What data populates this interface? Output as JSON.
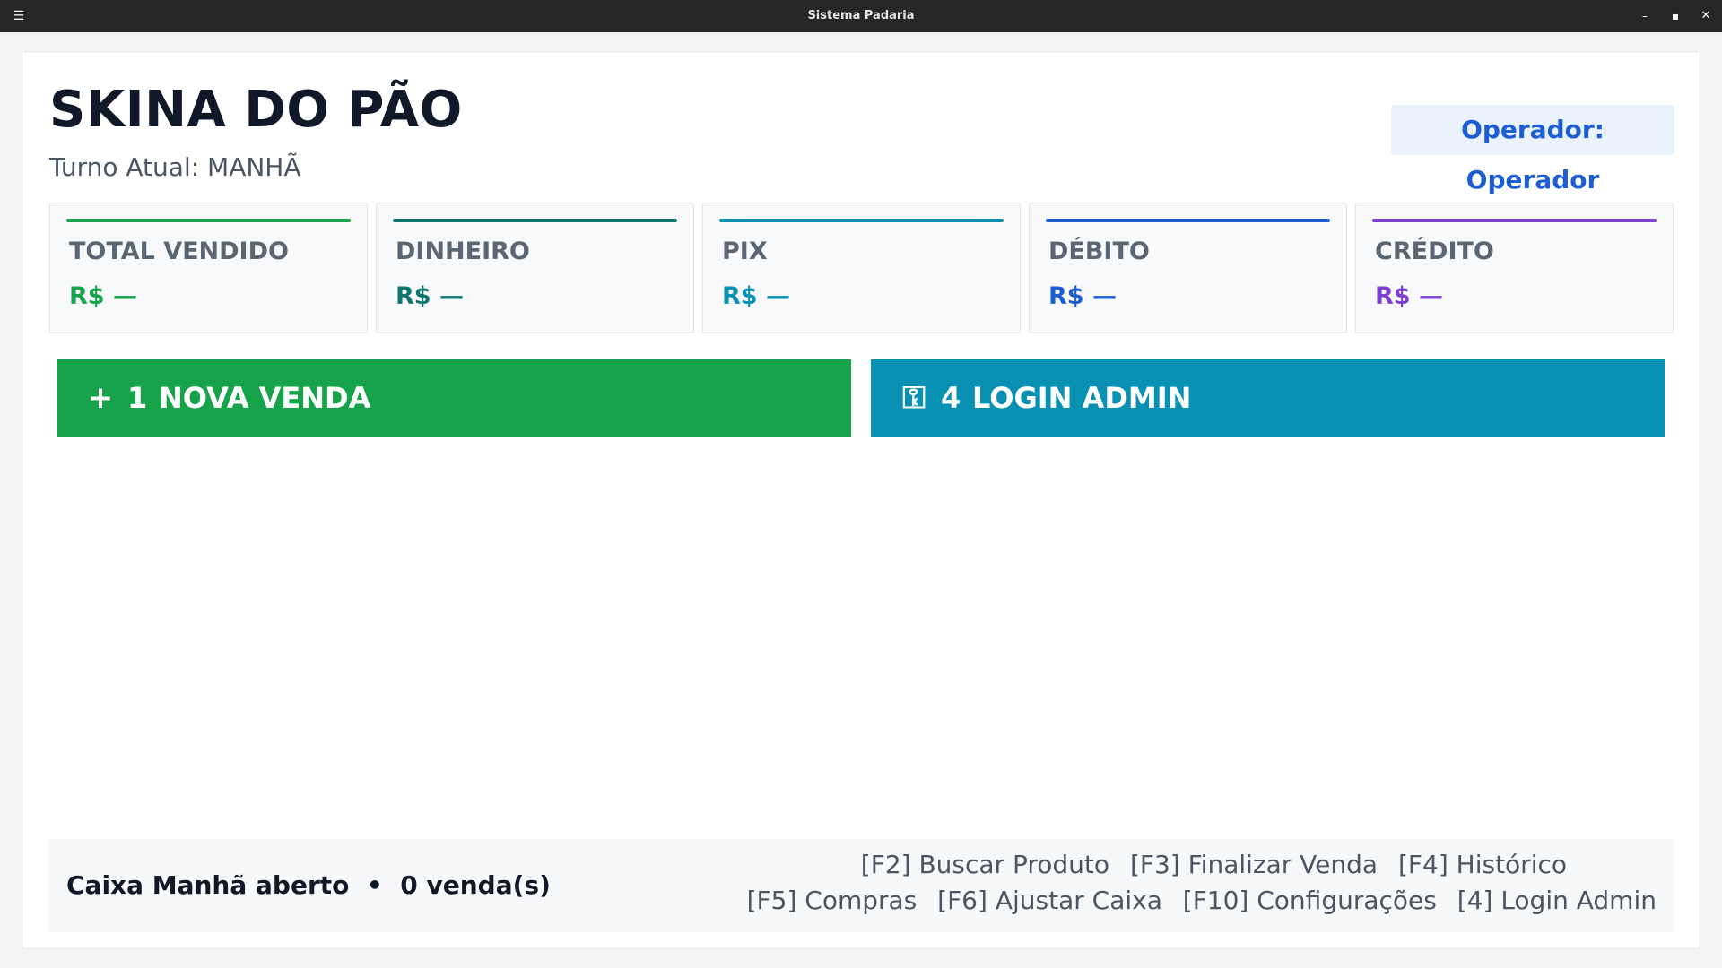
{
  "window": {
    "title": "Sistema Padaria",
    "menu_icon": "hamburger-icon",
    "minimize": "–",
    "maximize": "▪",
    "close": "✕"
  },
  "header": {
    "brand": "SKINA DO PÃO",
    "shift": "Turno Atual: MANHÃ",
    "operator": "Operador: Operador"
  },
  "stats": [
    {
      "label": "TOTAL VENDIDO",
      "value": "R$ —",
      "color": "#16a34a"
    },
    {
      "label": "DINHEIRO",
      "value": "R$ —",
      "color": "#0f766e"
    },
    {
      "label": "PIX",
      "value": "R$ —",
      "color": "#0891b2"
    },
    {
      "label": "DÉBITO",
      "value": "R$ —",
      "color": "#1d5fd3"
    },
    {
      "label": "CRÉDITO",
      "value": "R$ —",
      "color": "#7e3fd1"
    }
  ],
  "actions": {
    "new_sale": {
      "icon": "+",
      "key": "1",
      "label": "NOVA VENDA",
      "color": "#16a34a"
    },
    "login_admin": {
      "icon": "⚿",
      "key": "4",
      "label": "LOGIN ADMIN",
      "color": "#0891b2"
    }
  },
  "footer": {
    "status": "Caixa Manhã aberto  •  0 venda(s)",
    "shortcuts_row1": [
      "[F2] Buscar Produto",
      "[F3] Finalizar Venda",
      "[F4] Histórico"
    ],
    "shortcuts_row2": [
      "[F5] Compras",
      "[F6] Ajustar Caixa",
      "[F10] Configurações",
      "[4] Login Admin"
    ]
  }
}
